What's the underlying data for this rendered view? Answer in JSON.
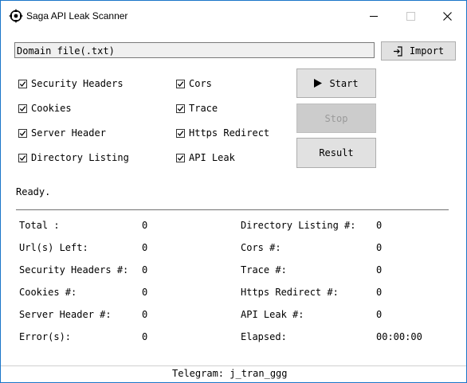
{
  "window": {
    "title": "Saga API Leak Scanner",
    "accent_color": "#1a75c9"
  },
  "domain_field": {
    "value": "Domain file(.txt)"
  },
  "buttons": {
    "import": "Import",
    "start": "Start",
    "stop": "Stop",
    "result": "Result"
  },
  "checks": [
    {
      "label": "Security Headers",
      "checked": true
    },
    {
      "label": "Cookies",
      "checked": true
    },
    {
      "label": "Server Header",
      "checked": true
    },
    {
      "label": "Directory Listing",
      "checked": true
    },
    {
      "label": "Cors",
      "checked": true
    },
    {
      "label": "Trace",
      "checked": true
    },
    {
      "label": "Https Redirect",
      "checked": true
    },
    {
      "label": "API Leak",
      "checked": true
    }
  ],
  "status": "Ready.",
  "stats_left": [
    {
      "label": "Total :",
      "value": "0"
    },
    {
      "label": "Url(s) Left:",
      "value": "0"
    },
    {
      "label": "Security Headers #:",
      "value": "0"
    },
    {
      "label": "Cookies #:",
      "value": "0"
    },
    {
      "label": "Server Header #:",
      "value": "0"
    },
    {
      "label": "Error(s):",
      "value": "0"
    }
  ],
  "stats_right": [
    {
      "label": "Directory Listing #:",
      "value": "0"
    },
    {
      "label": "Cors #:",
      "value": "0"
    },
    {
      "label": "Trace #:",
      "value": "0"
    },
    {
      "label": "Https Redirect #:",
      "value": "0"
    },
    {
      "label": "API Leak #:",
      "value": "0"
    },
    {
      "label": "Elapsed:",
      "value": "00:00:00"
    }
  ],
  "footer": "Telegram: j_tran_ggg",
  "icons": {
    "app": "target-icon",
    "import": "sign-in-icon",
    "start": "play-icon",
    "minimize": "minimize-icon",
    "maximize": "maximize-icon",
    "close": "close-icon"
  }
}
